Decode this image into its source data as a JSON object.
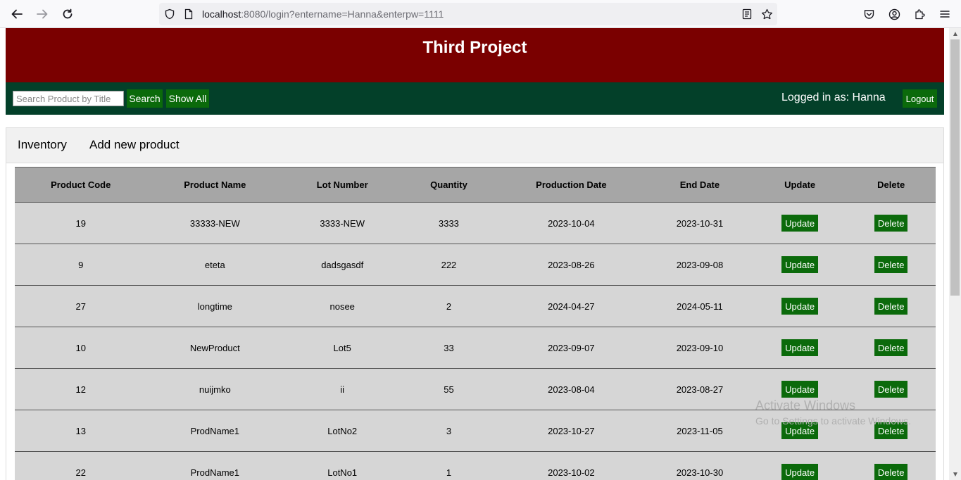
{
  "browser": {
    "url_host": "localhost",
    "url_rest": ":8080/login?entername=Hanna&enterpw=1111"
  },
  "header": {
    "title": "Third Project"
  },
  "navbar": {
    "search_placeholder": "Search Product by Title",
    "search_label": "Search",
    "show_all_label": "Show All",
    "logged_in_text": "Logged in as: Hanna",
    "logout_label": "Logout"
  },
  "tabs": [
    {
      "label": "Inventory"
    },
    {
      "label": "Add new product"
    }
  ],
  "table": {
    "columns": [
      "Product Code",
      "Product Name",
      "Lot Number",
      "Quantity",
      "Production Date",
      "End Date",
      "Update",
      "Delete"
    ],
    "update_label": "Update",
    "delete_label": "Delete",
    "rows": [
      {
        "code": "19",
        "name": "33333-NEW",
        "lot": "3333-NEW",
        "qty": "3333",
        "prod": "2023-10-04",
        "end": "2023-10-31"
      },
      {
        "code": "9",
        "name": "eteta",
        "lot": "dadsgasdf",
        "qty": "222",
        "prod": "2023-08-26",
        "end": "2023-09-08"
      },
      {
        "code": "27",
        "name": "longtime",
        "lot": "nosee",
        "qty": "2",
        "prod": "2024-04-27",
        "end": "2024-05-11"
      },
      {
        "code": "10",
        "name": "NewProduct",
        "lot": "Lot5",
        "qty": "33",
        "prod": "2023-09-07",
        "end": "2023-09-10"
      },
      {
        "code": "12",
        "name": "nuijmko",
        "lot": "ii",
        "qty": "55",
        "prod": "2023-08-04",
        "end": "2023-08-27"
      },
      {
        "code": "13",
        "name": "ProdName1",
        "lot": "LotNo2",
        "qty": "3",
        "prod": "2023-10-27",
        "end": "2023-11-05"
      },
      {
        "code": "22",
        "name": "ProdName1",
        "lot": "LotNo1",
        "qty": "1",
        "prod": "2023-10-02",
        "end": "2023-10-30"
      }
    ]
  },
  "watermark": {
    "line1": "Activate Windows",
    "line2": "Go to Settings to activate Windows."
  },
  "colors": {
    "header_bg": "#7a0000",
    "navbar_bg": "#034029",
    "button_green": "#0b6a0b",
    "table_header_bg": "#a6a6a6",
    "table_row_bg": "#d6d6d6"
  }
}
